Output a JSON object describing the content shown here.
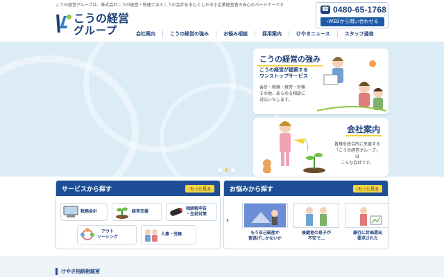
{
  "header": {
    "tagline": "こうの経営グループは、株式会社こうの経営・税理士法人こうの会計を中心とした中小企業経営者の安心のパートナーです",
    "logo_line1": "こうの経営",
    "logo_line2": "グループ",
    "phone": "0480-65-1768",
    "web_contact": "WEBから問い合わせる"
  },
  "nav": [
    "会社案内",
    "こうの経営の強み",
    "お悩み相談",
    "採用案内",
    "けやきニュース",
    "スタッフ通信"
  ],
  "hero": {
    "card1": {
      "title": "こうの経営の強み",
      "subtitle": [
        "こうの経営が提案する",
        "ワンストップサービス"
      ],
      "body": [
        "会計・税務・経営・労務",
        "その他、あらゆる相談に",
        "対応いたします。"
      ]
    },
    "card2": {
      "title": "会社案内",
      "body": [
        "皆様を総合的に支援する",
        "「こうの経営グループ」は",
        "こんな会社です。"
      ]
    }
  },
  "services_panel": {
    "title": "サービスから探す",
    "more": "もっと見る",
    "items": [
      {
        "label": "税務会計",
        "icon": "computer-icon"
      },
      {
        "label": "経営支援",
        "icon": "sprout-icon"
      },
      {
        "label": "相続税申告\n・生前対策",
        "icon": "scroll-icon"
      },
      {
        "label": "アウト\nソーシング",
        "icon": "cycle-icon"
      },
      {
        "label": "人事・労務",
        "icon": "people-icon"
      }
    ]
  },
  "worries_panel": {
    "title": "お悩みから探す",
    "more": "もっと見る",
    "items": [
      {
        "label": "もう自己破産か\n夜逃げしかないか",
        "icon": "worried-man-icon"
      },
      {
        "label": "後継者の息子が\n不安で…",
        "icon": "family-icon"
      },
      {
        "label": "銀行に計画提出\n要求された",
        "icon": "bank-icon"
      }
    ]
  },
  "lower": {
    "title": "けやき相続相談室"
  },
  "colors": {
    "navy": "#1d3f7a",
    "accent_blue": "#1d4e96",
    "yellow": "#f5d33e",
    "hero_bg": "#dbecf7"
  }
}
